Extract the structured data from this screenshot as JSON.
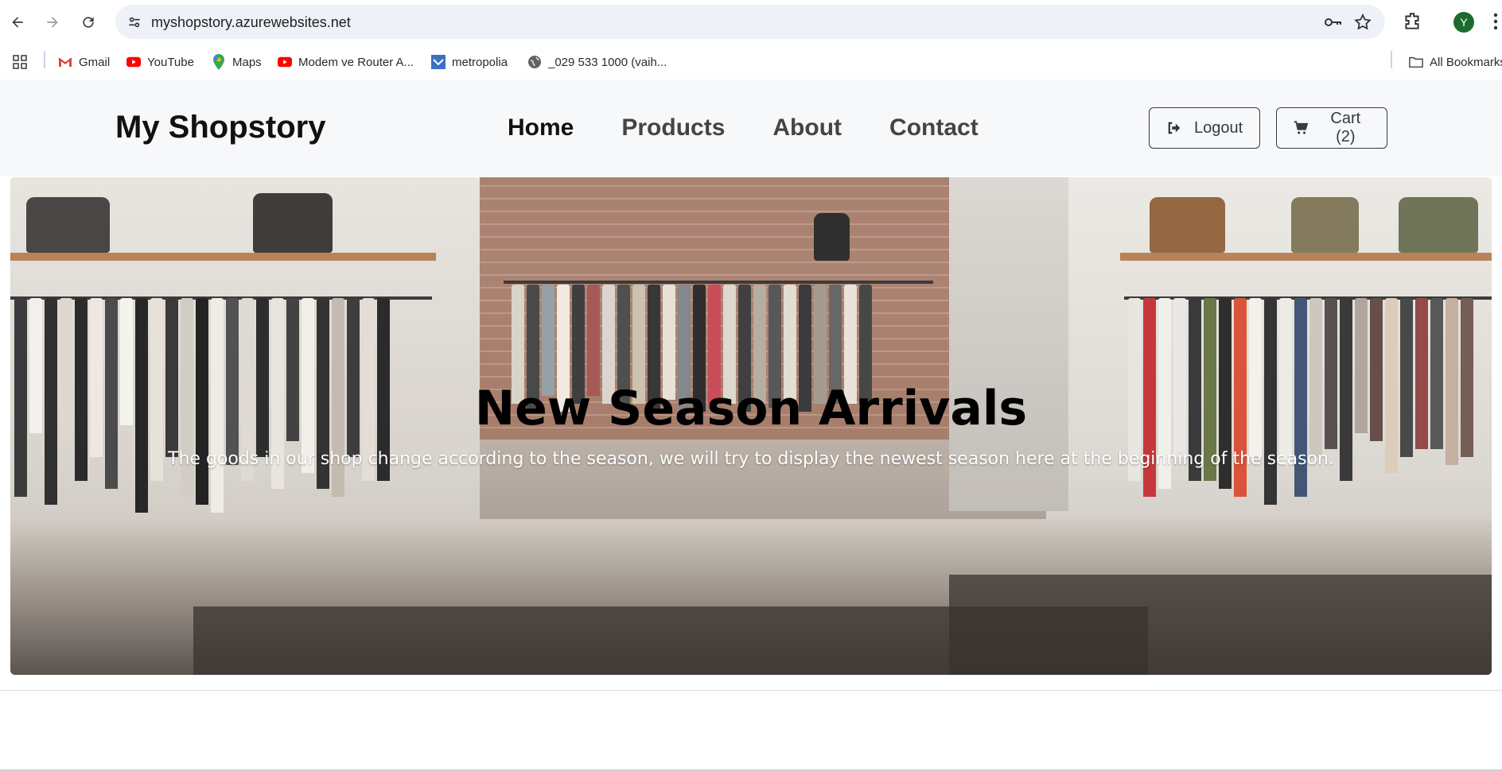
{
  "browser": {
    "url": "myshopstory.azurewebsites.net",
    "profile_initial": "Y",
    "profile_color": "#1e6b30",
    "bookmarks": [
      {
        "label": "Gmail",
        "icon": "gmail-icon"
      },
      {
        "label": "YouTube",
        "icon": "youtube-icon"
      },
      {
        "label": "Maps",
        "icon": "maps-icon"
      },
      {
        "label": "Modem ve Router A...",
        "icon": "youtube-icon"
      },
      {
        "label": "metropolia",
        "icon": "metropolia-icon"
      },
      {
        "label": "_029 533 1000 (vaih...",
        "icon": "globe-icon"
      }
    ],
    "all_bookmarks_label": "All Bookmarks"
  },
  "site": {
    "brand": "My Shopstory",
    "nav": [
      {
        "label": "Home",
        "active": true
      },
      {
        "label": "Products",
        "active": false
      },
      {
        "label": "About",
        "active": false
      },
      {
        "label": "Contact",
        "active": false
      }
    ],
    "logout_label": "Logout",
    "cart_label": "Cart (2)"
  },
  "hero": {
    "title": "New Season Arrivals",
    "text": "The goods in our shop change according to the season, we will try to display the newest season here at the beginning of the season."
  }
}
